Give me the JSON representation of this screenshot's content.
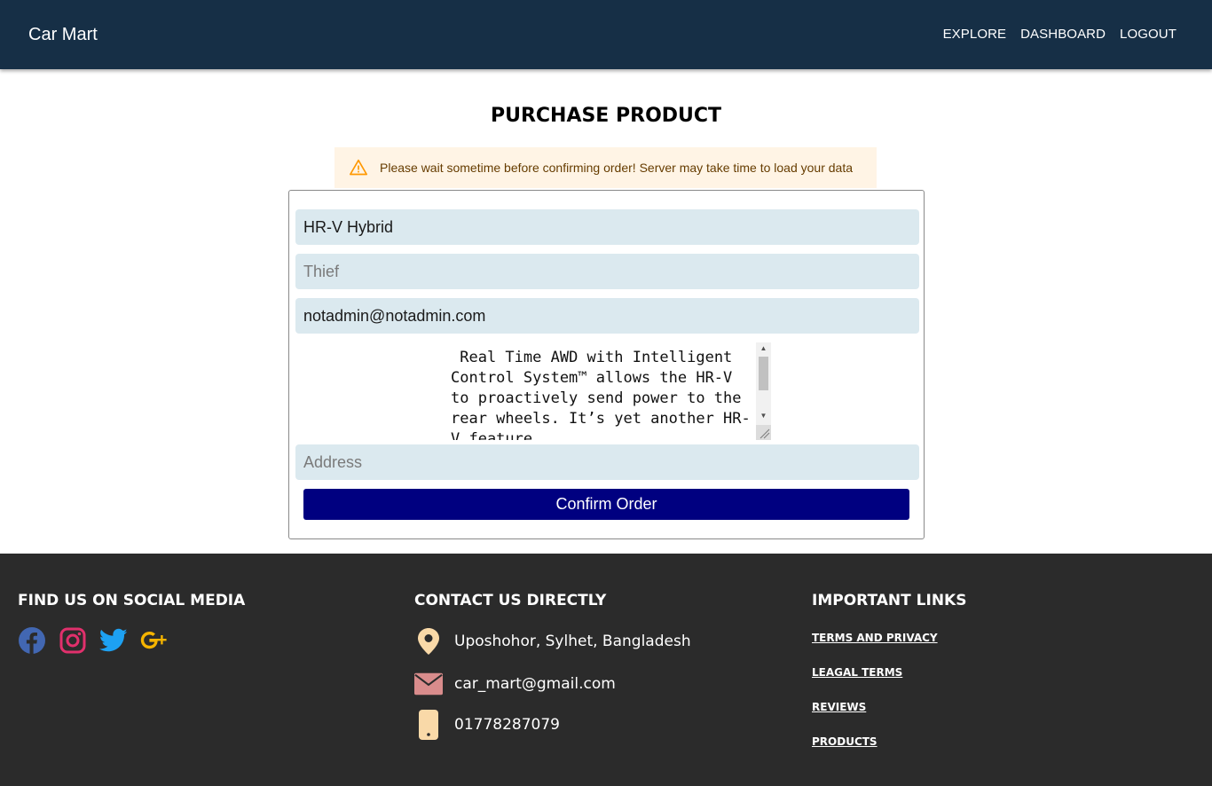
{
  "nav": {
    "brand": "Car Mart",
    "links": [
      "EXPLORE",
      "DASHBOARD",
      "LOGOUT"
    ]
  },
  "page": {
    "title": "PURCHASE PRODUCT",
    "alert_text": "Please wait sometime before confirming order! Server may take time to load your data"
  },
  "form": {
    "product_value": "HR-V Hybrid",
    "name_placeholder": "Thief",
    "email_value": "notadmin@notadmin.com",
    "description_value": " Real Time AWD with Intelligent Control System™ allows the HR-V to proactively send power to the rear wheels. It’s yet another HR-V feature",
    "address_placeholder": "Address",
    "confirm_label": "Confirm Order"
  },
  "footer": {
    "social_heading": "FIND US ON SOCIAL MEDIA",
    "social_icons": [
      "facebook-icon",
      "instagram-icon",
      "twitter-icon",
      "google-plus-icon"
    ],
    "contact_heading": "CONTACT US DIRECTLY",
    "address": "Uposhohor, Sylhet, Bangladesh",
    "email": "car_mart@gmail.com",
    "phone": "01778287079",
    "links_heading": "IMPORTANT LINKS",
    "links": [
      "TERMS AND PRIVACY",
      "LEAGAL TERMS",
      "REVIEWS",
      "PRODUCTS"
    ]
  },
  "colors": {
    "navbar": "#162f46",
    "alert_bg": "#fff4e5",
    "alert_icon": "#ff9800",
    "field_bg": "#dbe9ef",
    "button": "#000080",
    "footer": "#2b2b2b",
    "facebook": "#4267b2",
    "instagram": "#e1306c",
    "twitter": "#1da1f2",
    "google_plus": "#f5b400",
    "location_icon": "#f9d9a8",
    "mail_icon": "#d98c8c",
    "phone_icon": "#f9d9a8"
  }
}
